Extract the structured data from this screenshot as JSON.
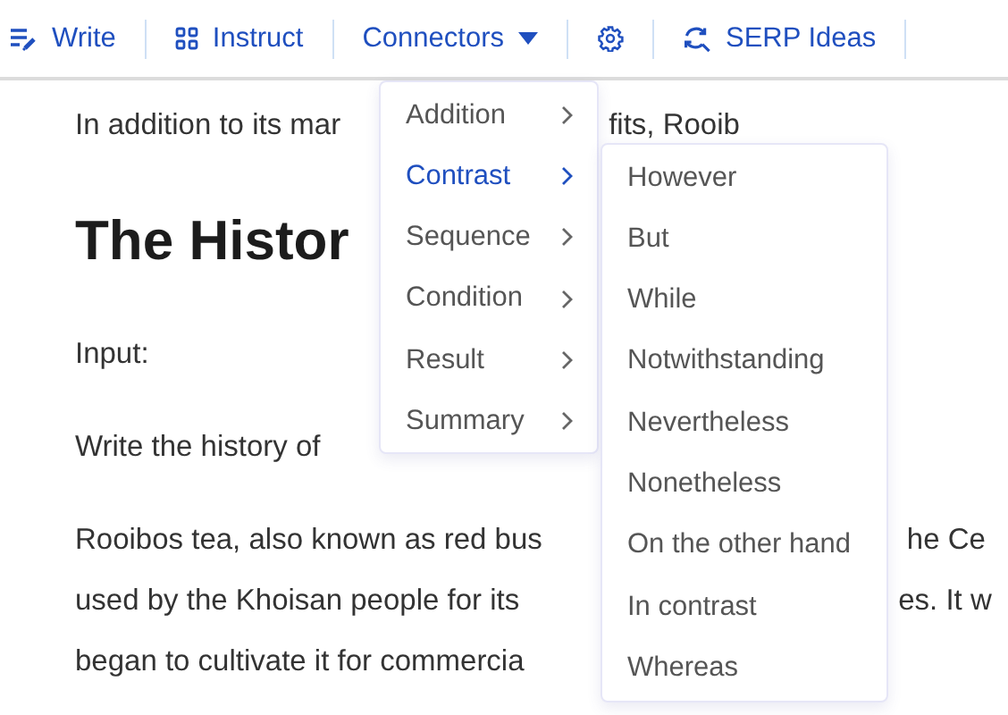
{
  "toolbar": [
    {
      "kind": "write",
      "label": "Write"
    },
    {
      "kind": "instruct",
      "label": "Instruct"
    },
    {
      "kind": "dropdown",
      "label": "Connectors",
      "expanded": true
    },
    {
      "kind": "settings"
    },
    {
      "kind": "serp",
      "label": "SERP Ideas"
    }
  ],
  "document": [
    {
      "kind": "paragraph",
      "left": "In addition to its mar",
      "right": "fits, Rooib"
    },
    {
      "kind": "heading",
      "left": "The Histor"
    },
    {
      "kind": "paragraph",
      "left": "Input:"
    },
    {
      "kind": "paragraph",
      "left": "Write the history of"
    },
    {
      "kind": "paragraph",
      "left": "Rooibos tea, also known as red bus",
      "right": "he Ce"
    },
    {
      "kind": "line",
      "left": "used by the Khoisan people for its",
      "right": "es. It w"
    },
    {
      "kind": "line",
      "left": "began to cultivate it for commercia"
    }
  ],
  "connector_menu": [
    {
      "label": "Addition",
      "selected": false
    },
    {
      "label": "Contrast",
      "selected": true
    },
    {
      "label": "Sequence",
      "selected": false
    },
    {
      "label": "Condition",
      "selected": false
    },
    {
      "label": "Result",
      "selected": false
    },
    {
      "label": "Summary",
      "selected": false
    }
  ],
  "submenu": [
    "However",
    "But",
    "While",
    "Notwithstanding",
    "Nevertheless",
    "Nonetheless",
    "On the other hand",
    "In contrast",
    "Whereas"
  ]
}
